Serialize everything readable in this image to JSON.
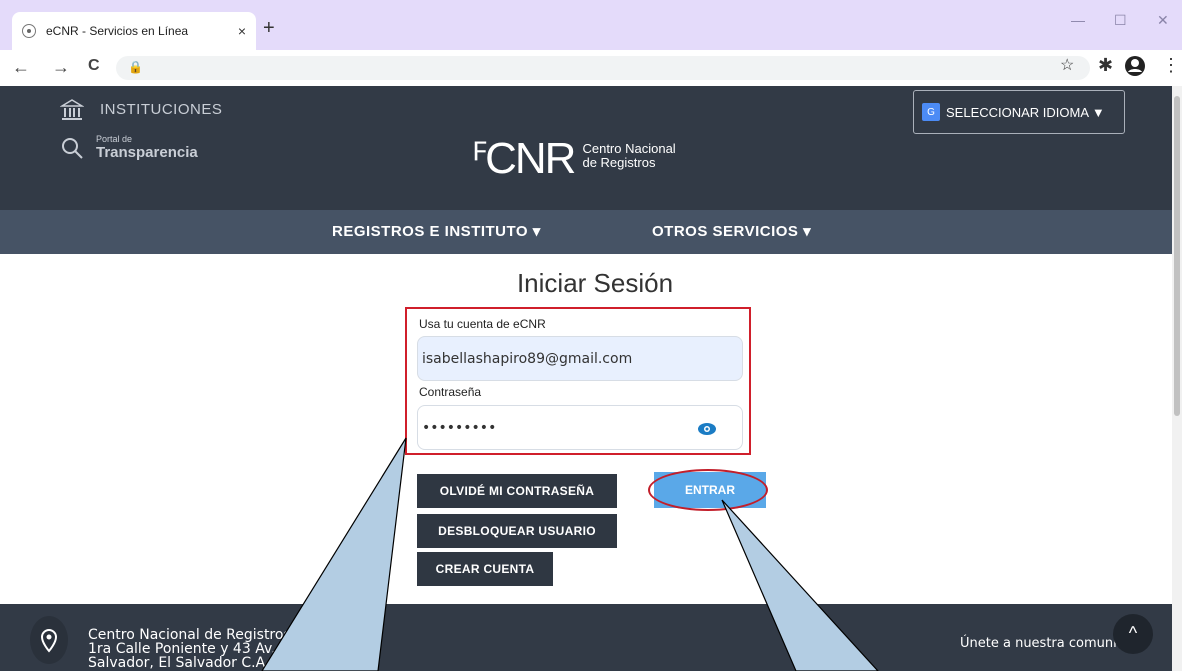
{
  "browser": {
    "tab_title": "eCNR - Servicios en Línea",
    "tab_close": "×",
    "new_tab": "+",
    "lock": "🔒",
    "star": "☆",
    "ext": "✱",
    "menu": "⋮",
    "back": "←",
    "forward": "→",
    "reload": "C",
    "minimize": "—",
    "maximize": "☐",
    "close": "✕"
  },
  "header": {
    "instituciones": "INSTITUCIONES",
    "portal_small": "Portal de",
    "portal_big": "Transparencia",
    "logo_mark": "ꟳCNR",
    "logo_line1": "Centro Nacional",
    "logo_line2": "de Registros",
    "language_button": "SELECCIONAR IDIOMA ▼",
    "translate_icon_text": "G"
  },
  "nav": {
    "item1": "REGISTROS E INSTITUTO ▾",
    "item2": "OTROS SERVICIOS ▾"
  },
  "login": {
    "title": "Iniciar Sesión",
    "account_label": "Usa tu cuenta de eCNR",
    "email_value": "isabellashapiro89@gmail.com",
    "password_label": "Contraseña",
    "password_value": "•••••••••",
    "forgot_button": "OLVIDÉ MI CONTRASEÑA",
    "unlock_button": "DESBLOQUEAR USUARIO",
    "create_button": "CREAR CUENTA",
    "enter_button": "ENTRAR"
  },
  "footer": {
    "line1": "Centro Nacional de Registros",
    "line2": "1ra Calle Poniente y 43 Av. Norte, San",
    "line3": "Salvador, El Salvador C.A.",
    "community": "Únete a nuestra comunidad",
    "to_top": "^"
  },
  "colors": {
    "header_bg": "#323a46",
    "nav_bg": "#465365",
    "highlight_red": "#d01f2b",
    "enter_blue": "#5aa8e8",
    "callout_fill": "#b3cde3"
  }
}
